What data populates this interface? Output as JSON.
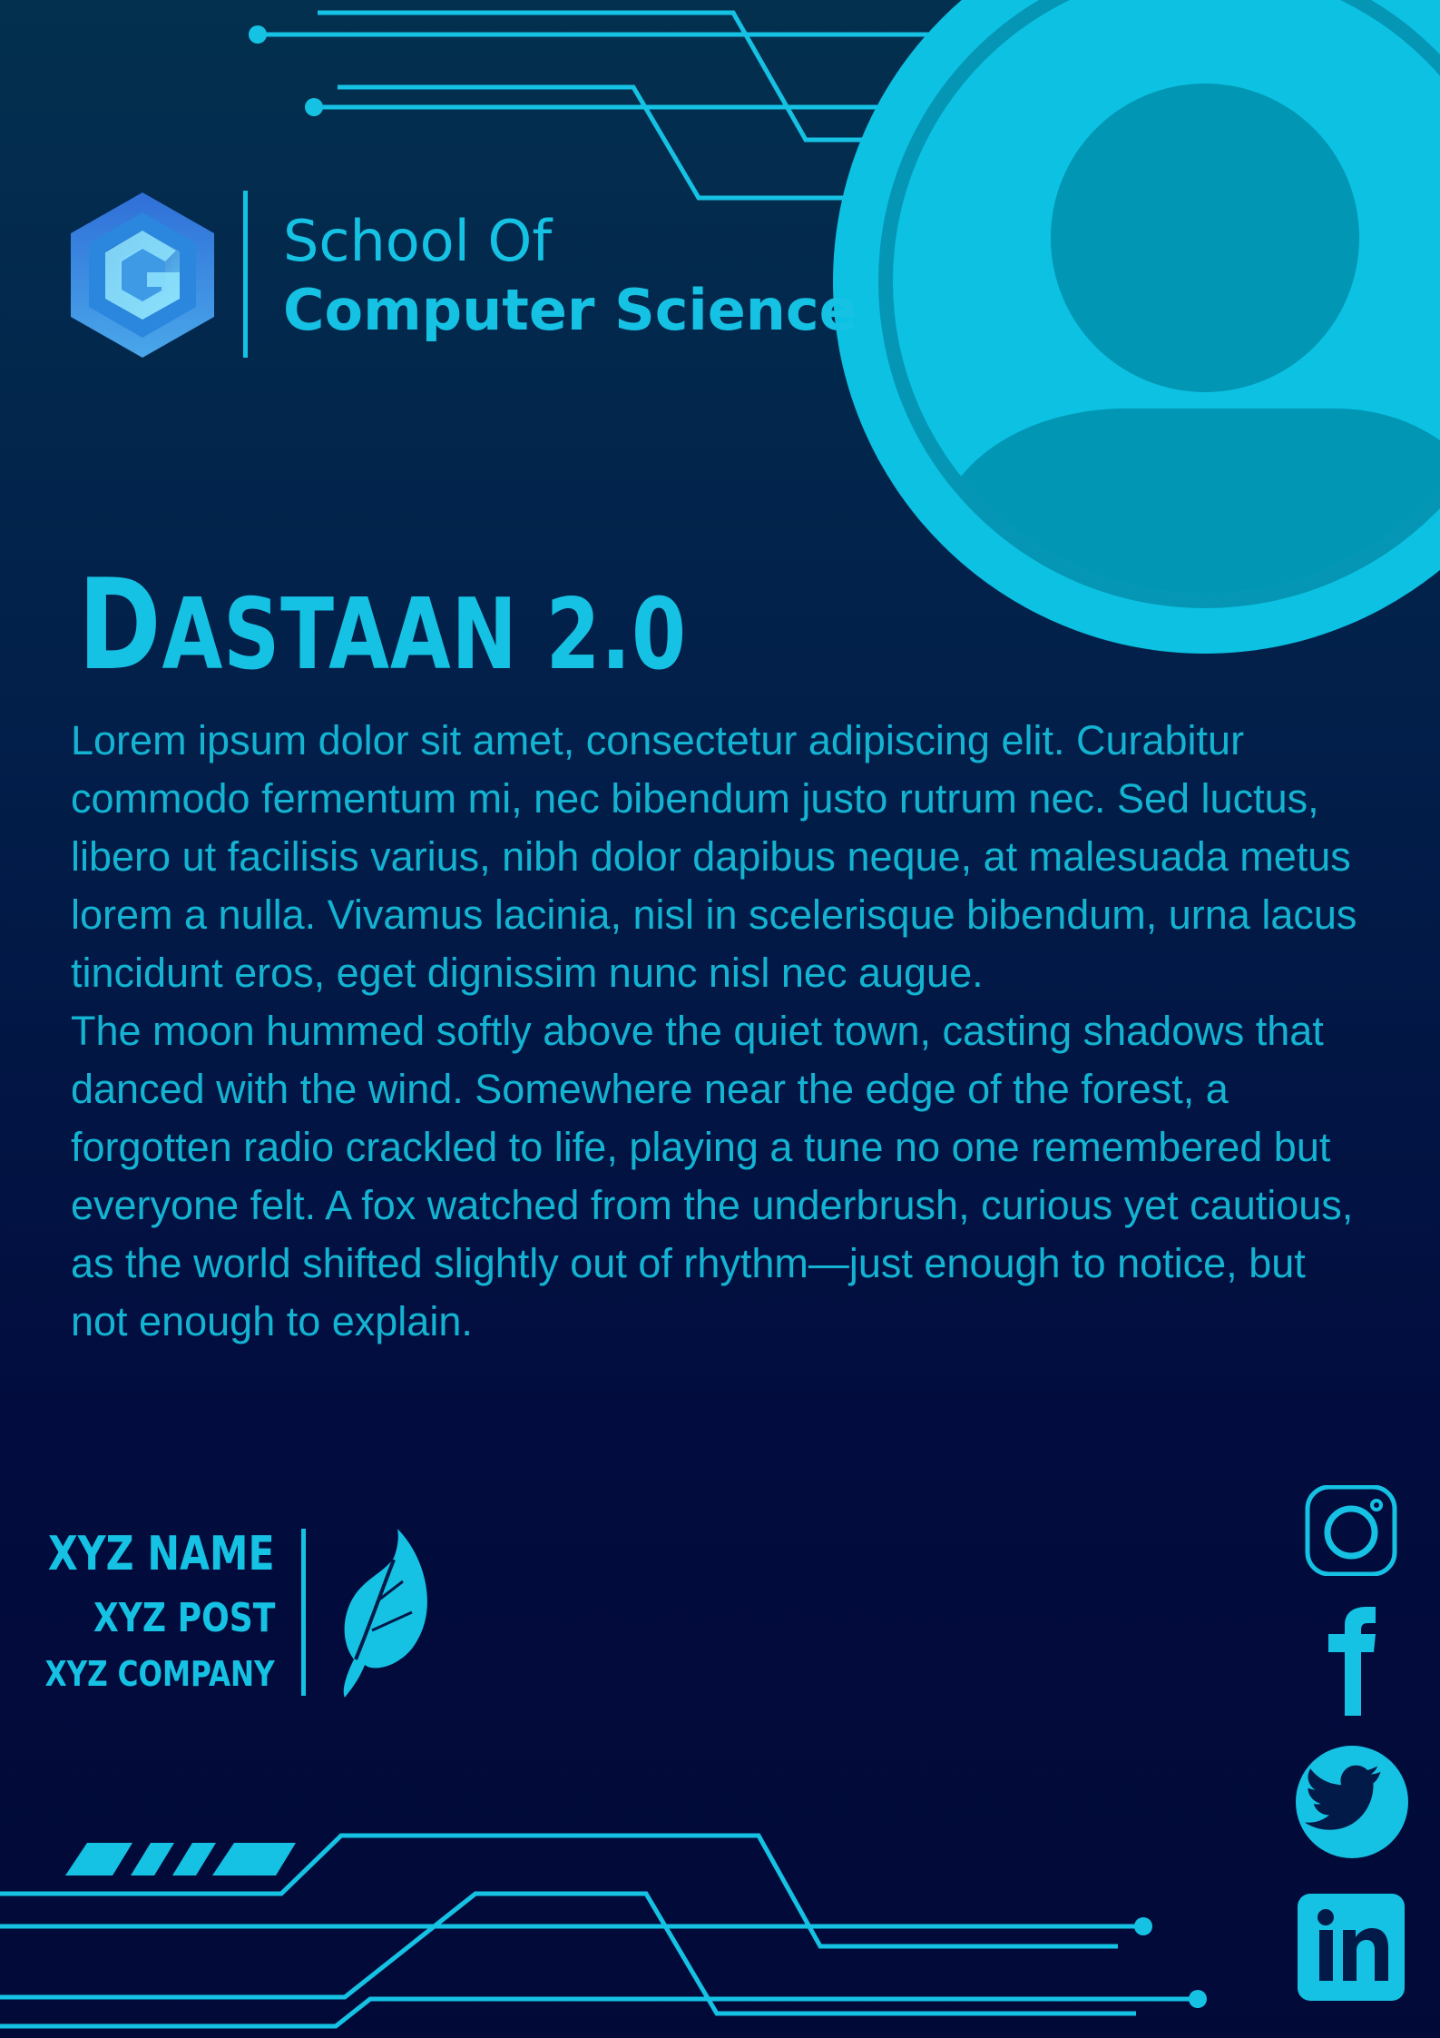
{
  "header": {
    "school_line1": "School Of",
    "school_line2": "Computer Science"
  },
  "event": {
    "title_initial": "D",
    "title_rest": "ASTAAN 2.0"
  },
  "description": {
    "paragraph1": "Lorem ipsum dolor sit amet, consectetur adipiscing elit. Curabitur commodo fermentum mi, nec bibendum justo rutrum nec. Sed luctus, libero ut facilisis varius, nibh dolor dapibus neque, at malesuada metus lorem a nulla. Vivamus lacinia, nisl in scelerisque bibendum, urna lacus tincidunt eros, eget dignissim nunc nisl nec augue.",
    "paragraph2": "The moon hummed softly above the quiet town, casting shadows that danced with the wind. Somewhere near the edge of the forest, a forgotten radio crackled to life, playing a tune no one remembered but everyone felt. A fox watched from the underbrush, curious yet cautious, as the world shifted slightly out of rhythm—just enough to notice, but not enough to explain."
  },
  "signature": {
    "name": "XYZ NAME",
    "post": "XYZ POST",
    "company": "XYZ COMPANY"
  },
  "social": [
    "instagram-icon",
    "facebook-icon",
    "twitter-icon",
    "linkedin-icon"
  ],
  "colors": {
    "accent": "#16c2e4",
    "avatar_dark": "#0096b4",
    "background_top": "#03304f",
    "background_bottom": "#010a37"
  }
}
